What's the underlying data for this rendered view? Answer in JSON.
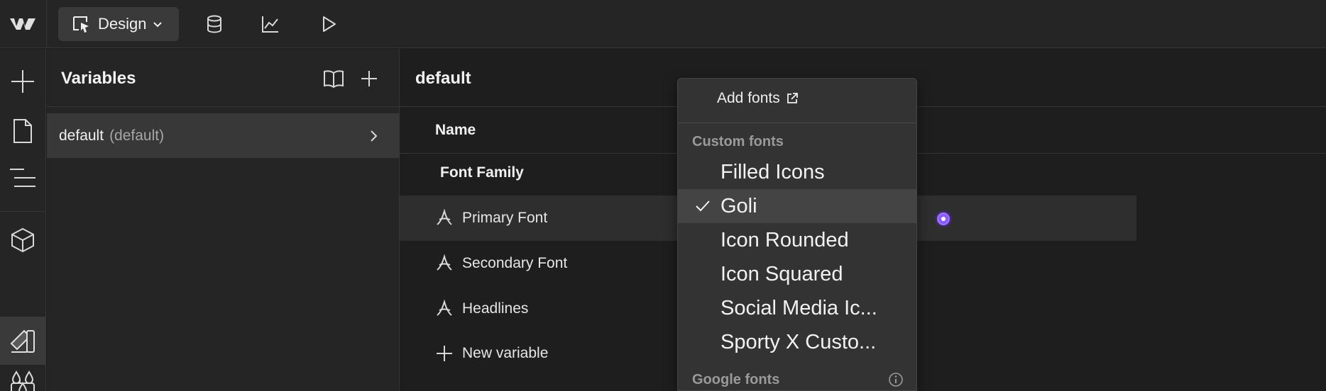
{
  "topbar": {
    "mode_label": "Design",
    "icons": [
      "webflow-logo-icon",
      "cursor-select-icon",
      "chevron-down-icon",
      "database-icon",
      "analytics-chart-icon",
      "play-icon"
    ]
  },
  "leftbar": {
    "icons": [
      "plus-icon",
      "page-icon",
      "navigator-icon",
      "components-cube-icon",
      "variables-icon",
      "color-drops-icon",
      "assets-icon"
    ]
  },
  "variables_panel": {
    "title": "Variables",
    "collection": {
      "name": "default",
      "tag": "(default)"
    }
  },
  "main": {
    "title": "default",
    "column_name": "Name",
    "group_title": "Font Family",
    "rows": [
      {
        "label": "Primary Font"
      },
      {
        "label": "Secondary Font"
      },
      {
        "label": "Headlines"
      }
    ],
    "new_variable": "New variable"
  },
  "dropdown": {
    "add_fonts": "Add fonts",
    "custom_section": "Custom fonts",
    "items": [
      {
        "label": "Filled Icons",
        "selected": false
      },
      {
        "label": "Goli",
        "selected": true
      },
      {
        "label": "Icon Rounded",
        "selected": false
      },
      {
        "label": "Icon Squared",
        "selected": false
      },
      {
        "label": "Social Media Ic...",
        "selected": false
      },
      {
        "label": "Sporty X Custo...",
        "selected": false
      }
    ],
    "google_section": "Google fonts"
  },
  "colors": {
    "accent": "#8b5cf6",
    "background": "#1e1e1e",
    "panel": "#252525"
  }
}
